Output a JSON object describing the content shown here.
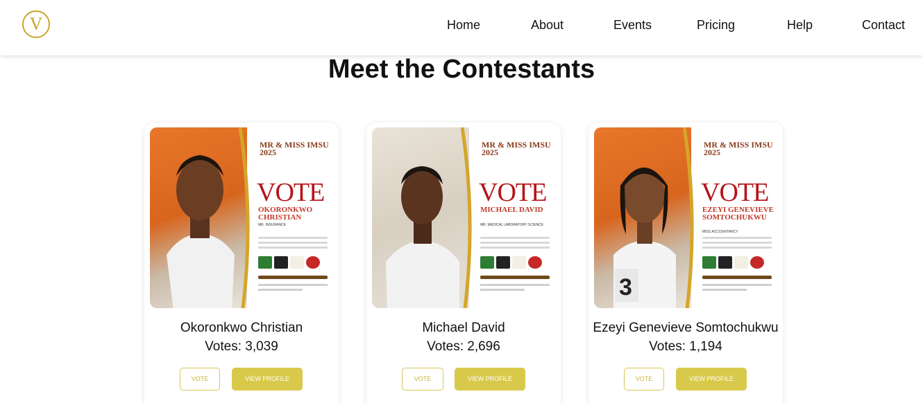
{
  "brand": {
    "logo_letter": "V",
    "accent": "#c9a52a"
  },
  "nav": {
    "items": [
      {
        "label": "Home"
      },
      {
        "label": "About"
      },
      {
        "label": "Events"
      },
      {
        "label": "Pricing"
      },
      {
        "label": "Help"
      },
      {
        "label": "Contact"
      }
    ]
  },
  "main": {
    "title": "Meet the Contestants"
  },
  "contestants": [
    {
      "name": "Okoronkwo Christian",
      "votes": "Votes: 3,039",
      "poster_name": "OKORONKWO CHRISTIAN",
      "poster_sub": "MR. INSURANCE",
      "vote_label": "VOTE",
      "profile_label": "VIEW PROFILE"
    },
    {
      "name": "Michael David",
      "votes": "Votes: 2,696",
      "poster_name": "MICHAEL DAVID",
      "poster_sub": "MR. MEDICAL LABORATORY SCIENCE",
      "vote_label": "VOTE",
      "profile_label": "VIEW PROFILE"
    },
    {
      "name": "Ezeyi Genevieve Somtochukwu",
      "votes": "Votes: 1,194",
      "poster_name": "EZEYI GENEVIEVE SOMTOCHUKWU",
      "poster_sub": "MISS ACCOUNTANCY",
      "vote_label": "VOTE",
      "profile_label": "VIEW PROFILE"
    }
  ],
  "poster": {
    "vote_word": "VOTE",
    "crest_text": "MR & MISS IMSU 2025"
  },
  "colors": {
    "button_fill": "#d8c94a",
    "button_border": "#d9c55a",
    "vote_red": "#b5141b"
  }
}
